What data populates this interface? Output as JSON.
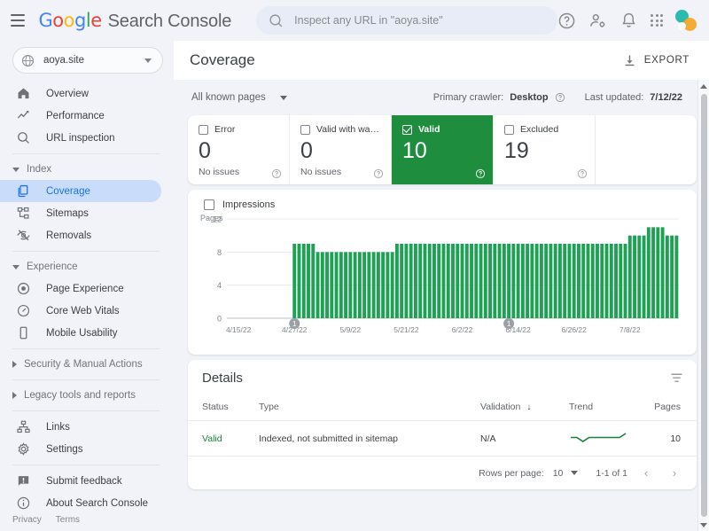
{
  "app": {
    "brand_google": "Google",
    "brand_title": "Search Console",
    "hamburger": "menu-icon"
  },
  "search": {
    "placeholder": "Inspect any URL in \"aoya.site\"",
    "value": ""
  },
  "topbar_icons": [
    "help-icon",
    "account-settings-icon",
    "notifications-icon",
    "apps-grid-icon",
    "avatar"
  ],
  "property": {
    "name": "aoya.site"
  },
  "sidebar": {
    "items": [
      {
        "label": "Overview",
        "icon": "home-icon",
        "type": "item",
        "active": false
      },
      {
        "label": "Performance",
        "icon": "trending-up-icon",
        "type": "item",
        "active": false
      },
      {
        "label": "URL inspection",
        "icon": "search-icon",
        "type": "item",
        "active": false
      },
      {
        "label": "Index",
        "icon": "chevron-down-icon",
        "type": "group",
        "open": true
      },
      {
        "label": "Coverage",
        "icon": "coverage-icon",
        "type": "item",
        "active": true
      },
      {
        "label": "Sitemaps",
        "icon": "sitemap-icon",
        "type": "item",
        "active": false
      },
      {
        "label": "Removals",
        "icon": "removals-icon",
        "type": "item",
        "active": false
      },
      {
        "label": "Experience",
        "icon": "chevron-down-icon",
        "type": "group",
        "open": true
      },
      {
        "label": "Page Experience",
        "icon": "page-experience-icon",
        "type": "item",
        "active": false
      },
      {
        "label": "Core Web Vitals",
        "icon": "speedometer-icon",
        "type": "item",
        "active": false
      },
      {
        "label": "Mobile Usability",
        "icon": "mobile-icon",
        "type": "item",
        "active": false
      },
      {
        "label": "Security & Manual Actions",
        "icon": "chevron-right-icon",
        "type": "group",
        "open": false
      },
      {
        "label": "Legacy tools and reports",
        "icon": "chevron-right-icon",
        "type": "group",
        "open": false
      },
      {
        "label": "Links",
        "icon": "links-icon",
        "type": "item",
        "active": false
      },
      {
        "label": "Settings",
        "icon": "gear-icon",
        "type": "item",
        "active": false
      },
      {
        "label": "Submit feedback",
        "icon": "feedback-icon",
        "type": "item",
        "active": false
      },
      {
        "label": "About Search Console",
        "icon": "info-icon",
        "type": "item",
        "active": false
      }
    ],
    "footer": {
      "privacy": "Privacy",
      "terms": "Terms"
    }
  },
  "main": {
    "page_title": "Coverage",
    "export_label": "EXPORT",
    "export_icon": "download-icon",
    "filter": {
      "pages_scope": "All known pages"
    },
    "meta": {
      "crawler_label": "Primary crawler:",
      "crawler_value": "Desktop",
      "updated_label": "Last updated:",
      "updated_value": "7/12/22"
    },
    "cards": [
      {
        "label": "Error",
        "value": "0",
        "sub": "No issues",
        "selected": false
      },
      {
        "label": "Valid with warnin…",
        "value": "0",
        "sub": "No issues",
        "selected": false
      },
      {
        "label": "Valid",
        "value": "10",
        "sub": "",
        "selected": true
      },
      {
        "label": "Excluded",
        "value": "19",
        "sub": "",
        "selected": false
      },
      {
        "label": "",
        "value": "",
        "sub": "",
        "selected": false
      }
    ],
    "legend": {
      "impressions": "Impressions"
    },
    "details": {
      "title": "Details",
      "filter_icon": "filter-icon",
      "columns": [
        "Status",
        "Type",
        "Validation",
        "Trend",
        "Pages"
      ],
      "sort_column": "Validation",
      "sort_arrow": "↓",
      "rows": [
        {
          "status": "Valid",
          "type": "Indexed, not submitted in sitemap",
          "validation": "N/A",
          "trend": "flat-sparkline",
          "pages": "10"
        }
      ],
      "pagination": {
        "rows_per_page_label": "Rows per page:",
        "rows_per_page_value": "10",
        "range": "1-1 of 1",
        "prev": "‹",
        "next": "›"
      }
    }
  },
  "chart_data": {
    "type": "bar",
    "title": "",
    "xlabel": "",
    "ylabel": "Pages",
    "ylim": [
      0,
      12
    ],
    "yticks": [
      0,
      4,
      8,
      12
    ],
    "grid": true,
    "legend_position": "top-left",
    "series": [
      {
        "name": "Valid",
        "color": "#1eA055",
        "values": [
          0,
          0,
          0,
          0,
          0,
          0,
          0,
          0,
          0,
          0,
          0,
          0,
          0,
          0,
          9,
          9,
          9,
          9,
          9,
          8,
          8,
          8,
          8,
          8,
          8,
          8,
          8,
          8,
          8,
          8,
          8,
          8,
          8,
          8,
          8,
          8,
          9,
          9,
          9,
          9,
          9,
          9,
          9,
          9,
          9,
          9,
          9,
          9,
          9,
          9,
          9,
          9,
          9,
          9,
          9,
          9,
          9,
          9,
          9,
          9,
          9,
          9,
          9,
          9,
          9,
          9,
          9,
          9,
          9,
          9,
          9,
          9,
          9,
          9,
          9,
          9,
          9,
          9,
          9,
          9,
          9,
          9,
          9,
          9,
          9,
          9,
          10,
          10,
          10,
          10,
          11,
          11,
          11,
          11,
          10,
          10,
          10
        ]
      }
    ],
    "x_tick_labels": [
      "4/15/22",
      "4/27/22",
      "5/9/22",
      "5/21/22",
      "6/2/22",
      "6/14/22",
      "6/26/22",
      "7/8/22"
    ],
    "annotations": [
      {
        "label": "1",
        "x_index": 14
      },
      {
        "label": "1",
        "x_index": 60
      }
    ],
    "sparkline": {
      "name": "Trend",
      "color": "#188038",
      "values": [
        9,
        9,
        8,
        9,
        9,
        9,
        9,
        9,
        9,
        10
      ]
    }
  }
}
